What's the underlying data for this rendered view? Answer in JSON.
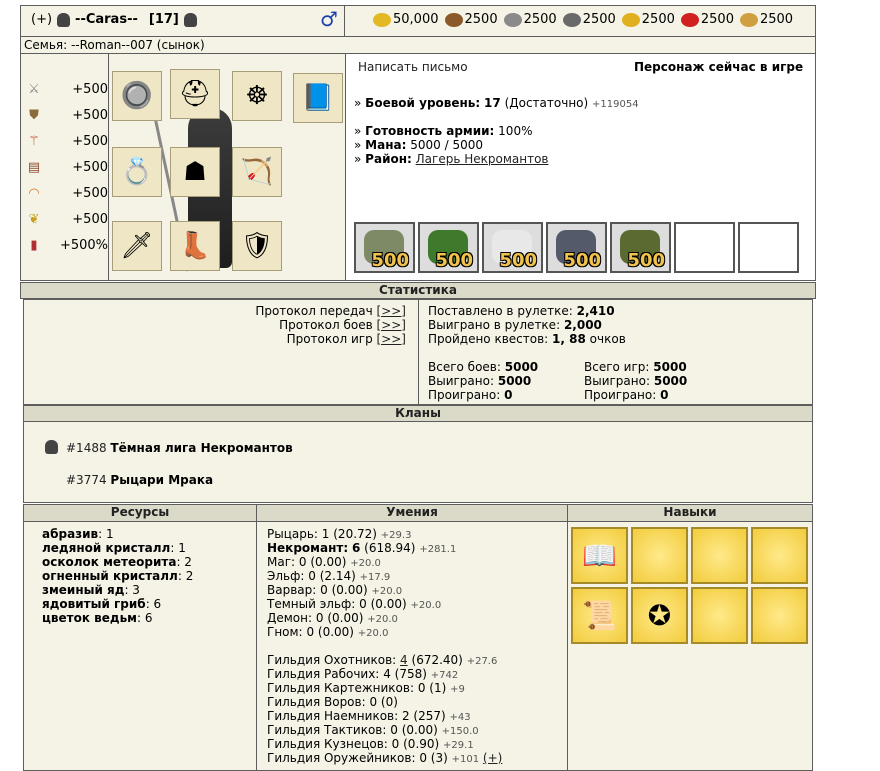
{
  "header": {
    "add_label": "(+)",
    "nick": "--Caras--",
    "level": "[17]",
    "gender_symbol": "♂",
    "resources": [
      {
        "icon": "gold-icon",
        "value": "50,000",
        "color": "#e4b825"
      },
      {
        "icon": "wood-icon",
        "value": "2500",
        "color": "#8b5a2b"
      },
      {
        "icon": "ore-icon",
        "value": "2500",
        "color": "#8a8a8a"
      },
      {
        "icon": "mercury-icon",
        "value": "2500",
        "color": "#6a6a6a"
      },
      {
        "icon": "sulfur-icon",
        "value": "2500",
        "color": "#e0b020"
      },
      {
        "icon": "crystal-icon",
        "value": "2500",
        "color": "#d02020"
      },
      {
        "icon": "gems-icon",
        "value": "2500",
        "color": "#d0a040"
      }
    ]
  },
  "family": "Семья: --Roman--007 (сынок)",
  "bonuses": [
    {
      "icon": "swords-icon",
      "value": "+500"
    },
    {
      "icon": "shield-icon",
      "value": "+500"
    },
    {
      "icon": "wand-icon",
      "value": "+500"
    },
    {
      "icon": "book-icon",
      "value": "+500"
    },
    {
      "icon": "rainbow-icon",
      "value": "+500"
    },
    {
      "icon": "wings-icon",
      "value": "+500"
    },
    {
      "icon": "potion-icon",
      "value": "+500%"
    }
  ],
  "info": {
    "write_letter": "Написать письмо",
    "online_status": "Персонаж сейчас в игре",
    "combat_level_label": "Боевой уровень:",
    "combat_level_value": "17",
    "combat_level_note": "(Достаточно)",
    "combat_level_exp": "+119054",
    "army_ready_label": "Готовность армии:",
    "army_ready_value": "100%",
    "mana_label": "Мана:",
    "mana_value": "5000 / 5000",
    "district_label": "Район:",
    "district_value": "Лагерь Некромантов",
    "bullet": "»"
  },
  "army": [
    {
      "count": "500",
      "icon": "soldier-icon",
      "color": "#7e8a66"
    },
    {
      "count": "500",
      "icon": "orc-icon",
      "color": "#3f7a2c"
    },
    {
      "count": "500",
      "icon": "skeleton-icon",
      "color": "#e8e8e8"
    },
    {
      "count": "500",
      "icon": "dark-elf-icon",
      "color": "#555a6a"
    },
    {
      "count": "500",
      "icon": "lich-icon",
      "color": "#5a6a30"
    }
  ],
  "stats": {
    "title": "Статистика",
    "protocols": [
      {
        "label": "Протокол передач",
        "link": "[>>]"
      },
      {
        "label": "Протокол боев",
        "link": "[>>]"
      },
      {
        "label": "Протокол игр",
        "link": "[>>]"
      }
    ],
    "roulette_bet_label": "Поставлено в рулетке:",
    "roulette_bet_value": "2,410",
    "roulette_win_label": "Выиграно в рулетке:",
    "roulette_win_value": "2,000",
    "quests_label": "Пройдено квестов:",
    "quests_value": "1, 88",
    "quests_unit": "очков",
    "battles_total_label": "Всего боев:",
    "battles_total_value": "5000",
    "battles_won_label": "Выиграно:",
    "battles_won_value": "5000",
    "battles_lost_label": "Проиграно:",
    "battles_lost_value": "0",
    "games_total_label": "Всего игр:",
    "games_total_value": "5000",
    "games_won_label": "Выиграно:",
    "games_won_value": "5000",
    "games_lost_label": "Проиграно:",
    "games_lost_value": "0"
  },
  "clans": {
    "title": "Кланы",
    "items": [
      {
        "id": "#1488",
        "name": "Тёмная лига Некромантов"
      },
      {
        "id": "#3774",
        "name": "Рыцари Мрака"
      }
    ]
  },
  "resources_panel": {
    "title": "Ресурсы",
    "items": [
      {
        "name": "абразив",
        "value": ": 1"
      },
      {
        "name": "ледяной кристалл",
        "value": ": 1"
      },
      {
        "name": "осколок метеорита",
        "value": ": 2"
      },
      {
        "name": "огненный кристалл",
        "value": ": 2"
      },
      {
        "name": "змеиный яд",
        "value": ": 3"
      },
      {
        "name": "ядовитый гриб",
        "value": ": 6"
      },
      {
        "name": "цветок ведьм",
        "value": ": 6"
      }
    ]
  },
  "skills": {
    "title": "Умения",
    "factions": [
      {
        "name": "Рыцарь:",
        "value": "1 (20.72)",
        "extra": "+29.3",
        "bold": false
      },
      {
        "name": "Некромант:",
        "value": "6",
        "value2": "(618.94)",
        "extra": "+281.1",
        "bold": true
      },
      {
        "name": "Маг:",
        "value": "0 (0.00)",
        "extra": "+20.0",
        "bold": false
      },
      {
        "name": "Эльф:",
        "value": "0 (2.14)",
        "extra": "+17.9",
        "bold": false
      },
      {
        "name": "Варвар:",
        "value": "0 (0.00)",
        "extra": "+20.0",
        "bold": false
      },
      {
        "name": "Темный эльф:",
        "value": "0 (0.00)",
        "extra": "+20.0",
        "bold": false
      },
      {
        "name": "Демон:",
        "value": "0 (0.00)",
        "extra": "+20.0",
        "bold": false
      },
      {
        "name": "Гном:",
        "value": "0 (0.00)",
        "extra": "+20.0",
        "bold": false
      }
    ],
    "guilds": [
      {
        "name": "Гильдия Охотников:",
        "link": "4",
        "value": "(672.40)",
        "extra": "+27.6"
      },
      {
        "name": "Гильдия Рабочих:",
        "value": "4 (758)",
        "extra": "+742"
      },
      {
        "name": "Гильдия Картежников:",
        "value": "0 (1)",
        "extra": "+9"
      },
      {
        "name": "Гильдия Воров:",
        "value": "0 (0)",
        "extra": ""
      },
      {
        "name": "Гильдия Наемников:",
        "value": "2 (257)",
        "extra": "+43"
      },
      {
        "name": "Гильдия Тактиков:",
        "value": "0 (0.00)",
        "extra": "+150.0"
      },
      {
        "name": "Гильдия Кузнецов:",
        "value": "0 (0.90)",
        "extra": "+29.1"
      },
      {
        "name": "Гильдия Оружейников:",
        "value": "0 (3)",
        "extra": "+101",
        "plus_link": "(+)"
      }
    ]
  },
  "abilities": {
    "title": "Навыки",
    "slots": [
      {
        "icon": "spellbook-icon",
        "glyph": "📖"
      },
      {
        "icon": "empty-slot",
        "glyph": ""
      },
      {
        "icon": "empty-slot",
        "glyph": ""
      },
      {
        "icon": "empty-slot",
        "glyph": ""
      },
      {
        "icon": "scroll-icon",
        "glyph": "📜"
      },
      {
        "icon": "fire-emblem-icon",
        "glyph": "✪"
      },
      {
        "icon": "empty-slot",
        "glyph": ""
      },
      {
        "icon": "empty-slot",
        "glyph": ""
      }
    ]
  },
  "equipment": [
    {
      "icon": "amulet-icon",
      "glyph": "🔘"
    },
    {
      "icon": "helmet-icon",
      "glyph": "⛑"
    },
    {
      "icon": "cloak-icon",
      "glyph": "☸"
    },
    {
      "icon": "spellbook-item-icon",
      "glyph": "📘"
    },
    {
      "icon": "ring-icon",
      "glyph": "💍"
    },
    {
      "icon": "armor-icon",
      "glyph": "☗"
    },
    {
      "icon": "bow-icon",
      "glyph": "🏹"
    },
    {
      "icon": "sword-icon",
      "glyph": "🗡"
    },
    {
      "icon": "boots-icon",
      "glyph": "👢"
    },
    {
      "icon": "shield-item-icon",
      "glyph": "🛡"
    }
  ]
}
